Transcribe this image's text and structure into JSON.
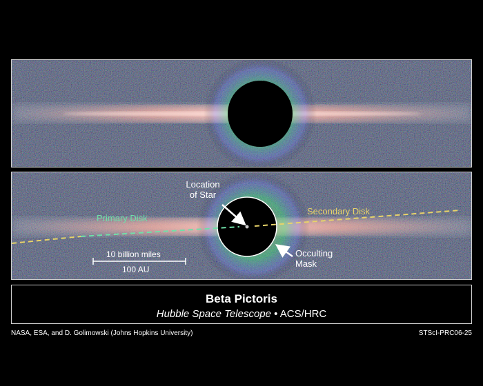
{
  "labels": {
    "star_location": [
      "Location",
      "of Star"
    ],
    "primary_disk": "Primary Disk",
    "secondary_disk": "Secondary Disk",
    "mask": [
      "Occulting",
      "Mask"
    ],
    "scale_miles": "10 billion miles",
    "scale_au": "100 AU"
  },
  "caption": {
    "title": "Beta Pictoris",
    "telescope": "Hubble Space Telescope",
    "separator": " • ",
    "instrument": "ACS/HRC"
  },
  "credits": {
    "left": "NASA, ESA, and D. Golimowski (Johns Hopkins University)",
    "right": "STScI-PRC06-25"
  },
  "colors": {
    "background": "#000000",
    "disk_glow": "#ffb0a0",
    "primary_disk_label": "#6fe0a8",
    "secondary_disk_label": "#e8d36a",
    "frame": "#cfcfcf"
  }
}
